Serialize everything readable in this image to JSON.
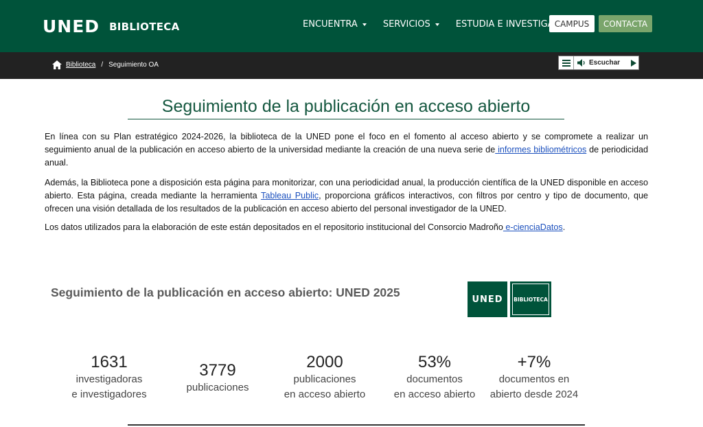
{
  "header": {
    "logo_uned": "UNED",
    "logo_biblioteca": "BIBLIOTECA",
    "nav": [
      "ENCUENTRA",
      "SERVICIOS",
      "ESTUDIA E INVESTIGA"
    ],
    "campus_label": "CAMPUS",
    "contacta_label": "CONTACTA"
  },
  "breadcrumb": {
    "home_label": "Biblioteca",
    "separator": "/",
    "current": "Seguimiento OA"
  },
  "listen": {
    "label": "Escuchar"
  },
  "main": {
    "title": "Seguimiento de la publicación en acceso abierto",
    "p1_before": "En línea con su Plan estratégico 2024-2026, la biblioteca de la UNED pone el foco en el fomento al acceso abierto y se compromete a realizar un seguimiento anual de la publicación en acceso abierto de la universidad mediante la creación de una nueva serie de",
    "p1_link": " informes bibliométricos",
    "p1_after": " de periodicidad anual.",
    "p2_before": "Además, la Biblioteca pone a disposición esta página para monitorizar, con una periodicidad anual, la producción científica de la UNED disponible en acceso abierto. Esta página, creada mediante la herramienta ",
    "p2_link": "Tableau Public",
    "p2_after": ", proporciona gráficos interactivos, con filtros por centro y tipo de documento, que ofrecen una visión detallada de los resultados de la publicación en acceso abierto del personal investigador de la UNED.",
    "p3_before": "Los datos utilizados para la elaboración de este están depositados en el repositorio institucional del Consorcio Madroño",
    "p3_link": " e-cienciaDatos",
    "p3_after": "."
  },
  "dashboard": {
    "title": "Seguimiento de la publicación en acceso abierto: UNED 2025",
    "logo_uned": "UNED",
    "logo_biblioteca": "BIBLIOTECA",
    "stats": [
      {
        "value": "1631",
        "line1": "investigadoras",
        "line2": "e investigadores"
      },
      {
        "value": "3779",
        "line1": "publicaciones",
        "line2": ""
      },
      {
        "value": "2000",
        "line1": "publicaciones",
        "line2": "en acceso abierto"
      },
      {
        "value": "53%",
        "line1": "documentos",
        "line2": "en acceso abierto"
      },
      {
        "value": "+7%",
        "line1": "documentos en",
        "line2": "abierto desde 2024"
      }
    ]
  },
  "colors": {
    "brand_green": "#00533a",
    "button_green": "#7aa56c",
    "link_blue": "#1a4fbd"
  }
}
